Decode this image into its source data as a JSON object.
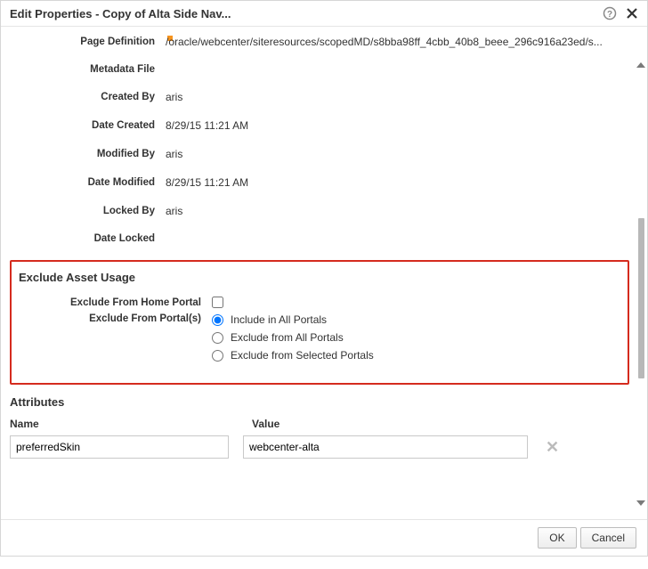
{
  "dialog": {
    "title": "Edit Properties - Copy of Alta Side Nav..."
  },
  "props": {
    "pageDefinition": {
      "label": "Page Definition",
      "value": "/oracle/webcenter/siteresources/scopedMD/s8bba98ff_4cbb_40b8_beee_296c916a23ed/s..."
    },
    "metadataFile": {
      "label": "Metadata File",
      "value": ""
    },
    "createdBy": {
      "label": "Created By",
      "value": "aris"
    },
    "dateCreated": {
      "label": "Date Created",
      "value": "8/29/15 11:21 AM"
    },
    "modifiedBy": {
      "label": "Modified By",
      "value": "aris"
    },
    "dateModified": {
      "label": "Date Modified",
      "value": "8/29/15 11:21 AM"
    },
    "lockedBy": {
      "label": "Locked By",
      "value": "aris"
    },
    "dateLocked": {
      "label": "Date Locked",
      "value": ""
    }
  },
  "exclude": {
    "title": "Exclude Asset Usage",
    "homeLabel": "Exclude From Home Portal",
    "portalsLabel": "Exclude From Portal(s)",
    "options": {
      "includeAll": "Include in All Portals",
      "excludeAll": "Exclude from All Portals",
      "excludeSelected": "Exclude from Selected Portals"
    }
  },
  "attributes": {
    "title": "Attributes",
    "nameHeader": "Name",
    "valueHeader": "Value",
    "rows": [
      {
        "name": "preferredSkin",
        "value": "webcenter-alta"
      }
    ]
  },
  "footer": {
    "ok": "OK",
    "cancel": "Cancel"
  }
}
